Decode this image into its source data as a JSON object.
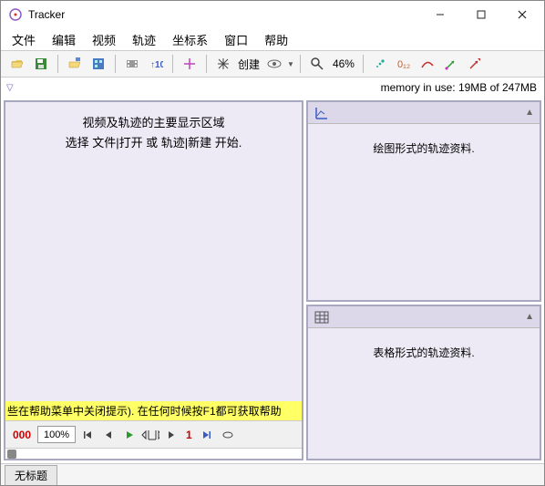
{
  "window": {
    "title": "Tracker"
  },
  "menu": {
    "file": "文件",
    "edit": "编辑",
    "video": "视频",
    "track": "轨迹",
    "coord": "坐标系",
    "window": "窗口",
    "help": "帮助"
  },
  "toolbar": {
    "create_label": "创建",
    "zoom_label": "46%"
  },
  "status": {
    "memory": "memory in use: 19MB of 247MB"
  },
  "video_panel": {
    "line1": "视频及轨迹的主要显示区域",
    "line2": "选择 文件|打开 或 轨迹|新建 开始.",
    "hint": "些在帮助菜单中关闭提示). 在任何时候按F1都可获取帮助"
  },
  "player": {
    "frame": "000",
    "percent": "100%",
    "step": "1"
  },
  "plot_panel": {
    "placeholder": "绘图形式的轨迹资料."
  },
  "table_panel": {
    "placeholder": "表格形式的轨迹资料."
  },
  "tab": {
    "untitled": "无标题"
  }
}
